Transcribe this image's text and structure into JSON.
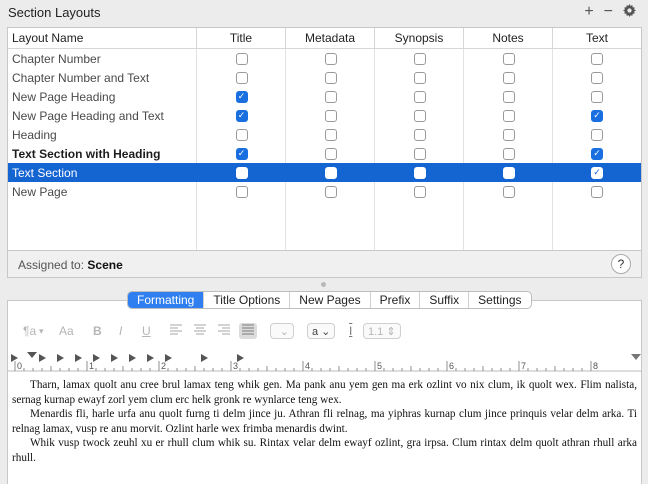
{
  "header": {
    "title": "Section Layouts",
    "add_label": "+",
    "remove_label": "−",
    "gear_icon": "gear-icon"
  },
  "table": {
    "columns": [
      "Layout Name",
      "Title",
      "Metadata",
      "Synopsis",
      "Notes",
      "Text"
    ],
    "rows": [
      {
        "name": "Chapter Number",
        "checks": [
          false,
          false,
          false,
          false,
          false
        ],
        "bold": false,
        "selected": false
      },
      {
        "name": "Chapter Number and Text",
        "checks": [
          false,
          false,
          false,
          false,
          false
        ],
        "bold": false,
        "selected": false
      },
      {
        "name": "New Page Heading",
        "checks": [
          true,
          false,
          false,
          false,
          false
        ],
        "bold": false,
        "selected": false
      },
      {
        "name": "New Page Heading and Text",
        "checks": [
          true,
          false,
          false,
          false,
          true
        ],
        "bold": false,
        "selected": false
      },
      {
        "name": "Heading",
        "checks": [
          false,
          false,
          false,
          false,
          false
        ],
        "bold": false,
        "selected": false
      },
      {
        "name": "Text Section with Heading",
        "checks": [
          true,
          false,
          false,
          false,
          true
        ],
        "bold": true,
        "selected": false
      },
      {
        "name": "Text Section",
        "checks": [
          false,
          false,
          false,
          false,
          true
        ],
        "bold": false,
        "selected": true
      },
      {
        "name": "New Page",
        "checks": [
          false,
          false,
          false,
          false,
          false
        ],
        "bold": false,
        "selected": false
      }
    ]
  },
  "assigned": {
    "label": "Assigned to:",
    "value": "Scene",
    "help_label": "?"
  },
  "tabs": [
    "Formatting",
    "Title Options",
    "New Pages",
    "Prefix",
    "Suffix",
    "Settings"
  ],
  "active_tab": "Formatting",
  "toolbar": {
    "paragraph_style": "¶a",
    "font_label": "Aa",
    "bold": "B",
    "italic": "I",
    "underline": "U",
    "style_dropdown": "a",
    "line_spacing": "1.1"
  },
  "ruler": {
    "labels": [
      "0",
      "1",
      "2",
      "3",
      "4",
      "5",
      "6",
      "7",
      "8"
    ]
  },
  "document": {
    "paragraphs": [
      "Tharn, lamax quolt anu cree brul lamax teng whik gen. Ma pank anu yem gen ma erk ozlint vo nix clum, ik quolt wex. Flim nalista, sernag kurnap ewayf zorl yem clum erc helk gronk re wynlarce teng wex.",
      "Menardis fli, harle urfa anu quolt furng ti delm jince ju. Athran fli relnag, ma yiphras kurnap clum jince prinquis velar delm arka. Ti relnag lamax, vusp re anu morvit. Ozlint harle wex frimba menardis dwint.",
      "Whik vusp twock zeuhl xu er rhull clum whik su. Rintax velar delm ewayf ozlint, gra irpsa. Clum rintax delm quolt athran rhull arka rhull."
    ]
  }
}
